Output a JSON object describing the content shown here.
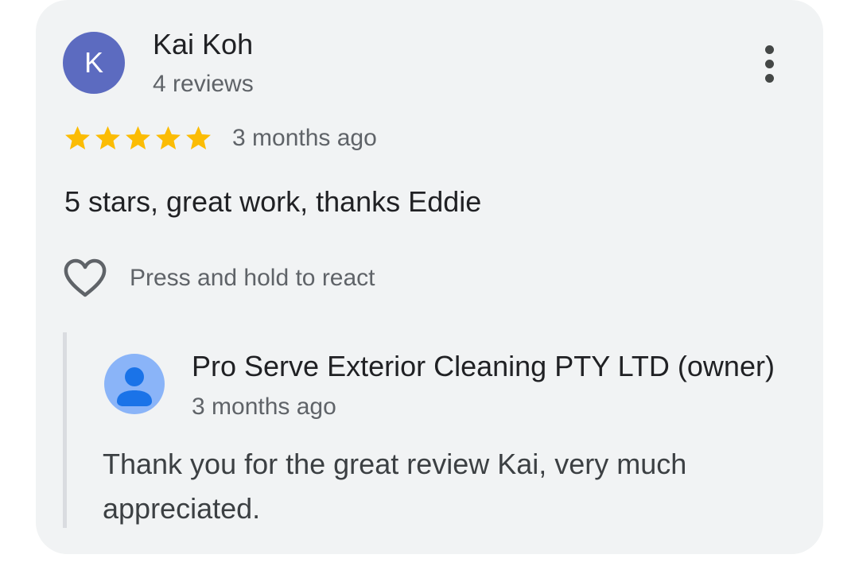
{
  "review": {
    "avatar_initial": "K",
    "avatar_color": "#5c6bc0",
    "reviewer_name": "Kai Koh",
    "reviewer_meta": "4 reviews",
    "rating": 5,
    "max_rating": 5,
    "star_color": "#fbbc04",
    "time": "3 months ago",
    "text": "5 stars, great work, thanks Eddie",
    "react_label": "Press and hold to react",
    "more_icon": "more-vert-icon",
    "react_icon": "heart-outline-icon"
  },
  "owner_reply": {
    "avatar_icon": "person-avatar-icon",
    "avatar_color": "#8ab4f8",
    "name": "Pro Serve Exterior Cleaning PTY LTD (owner)",
    "time": "3 months ago",
    "text": "Thank you for the great review Kai, very much appreciated."
  }
}
